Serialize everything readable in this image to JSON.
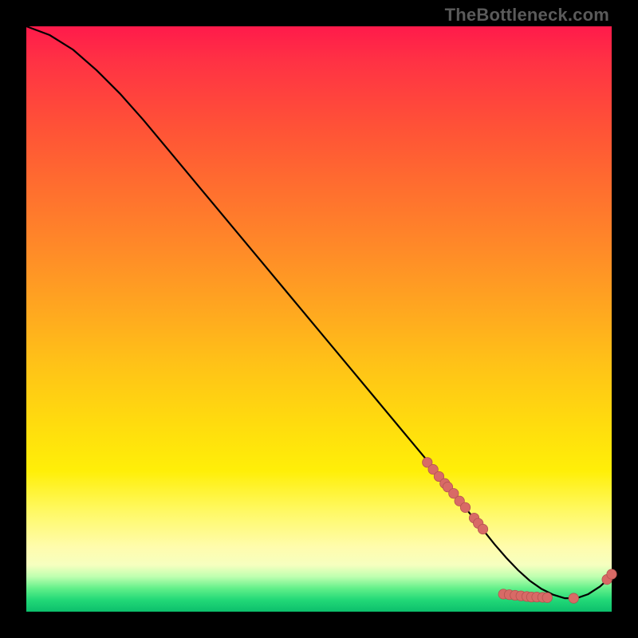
{
  "watermark": "TheBottleneck.com",
  "colors": {
    "curve_stroke": "#000000",
    "point_fill": "#d86a66",
    "point_stroke": "#b55350"
  },
  "chart_data": {
    "type": "line",
    "title": "",
    "xlabel": "",
    "ylabel": "",
    "xlim": [
      0,
      100
    ],
    "ylim": [
      0,
      100
    ],
    "grid": false,
    "legend": false,
    "series": [
      {
        "name": "bottleneck-curve",
        "x": [
          0,
          4,
          8,
          12,
          16,
          20,
          25,
          30,
          35,
          40,
          45,
          50,
          55,
          60,
          65,
          70,
          72,
          74,
          76,
          78,
          80,
          82,
          84,
          86,
          88,
          90,
          92,
          94,
          96,
          98,
          100
        ],
        "y": [
          100,
          98.5,
          96,
          92.5,
          88.5,
          84,
          78,
          72,
          66,
          60,
          54,
          48,
          42,
          36,
          30,
          24,
          21.5,
          19,
          16.5,
          14,
          11.5,
          9.2,
          7.1,
          5.3,
          3.9,
          2.9,
          2.3,
          2.3,
          3.0,
          4.3,
          6.1
        ]
      }
    ],
    "points": [
      {
        "x": 68.5,
        "y": 25.5
      },
      {
        "x": 69.5,
        "y": 24.3
      },
      {
        "x": 70.5,
        "y": 23.1
      },
      {
        "x": 71.5,
        "y": 21.9
      },
      {
        "x": 72.0,
        "y": 21.3
      },
      {
        "x": 73.0,
        "y": 20.2
      },
      {
        "x": 74.0,
        "y": 18.9
      },
      {
        "x": 75.0,
        "y": 17.8
      },
      {
        "x": 76.5,
        "y": 16.0
      },
      {
        "x": 77.2,
        "y": 15.1
      },
      {
        "x": 78.0,
        "y": 14.1
      },
      {
        "x": 81.5,
        "y": 3.0
      },
      {
        "x": 82.5,
        "y": 2.9
      },
      {
        "x": 83.5,
        "y": 2.8
      },
      {
        "x": 84.5,
        "y": 2.7
      },
      {
        "x": 85.5,
        "y": 2.6
      },
      {
        "x": 86.3,
        "y": 2.5
      },
      {
        "x": 87.2,
        "y": 2.5
      },
      {
        "x": 88.2,
        "y": 2.45
      },
      {
        "x": 89.0,
        "y": 2.4
      },
      {
        "x": 93.5,
        "y": 2.3
      },
      {
        "x": 99.2,
        "y": 5.5
      },
      {
        "x": 100.0,
        "y": 6.4
      }
    ]
  }
}
